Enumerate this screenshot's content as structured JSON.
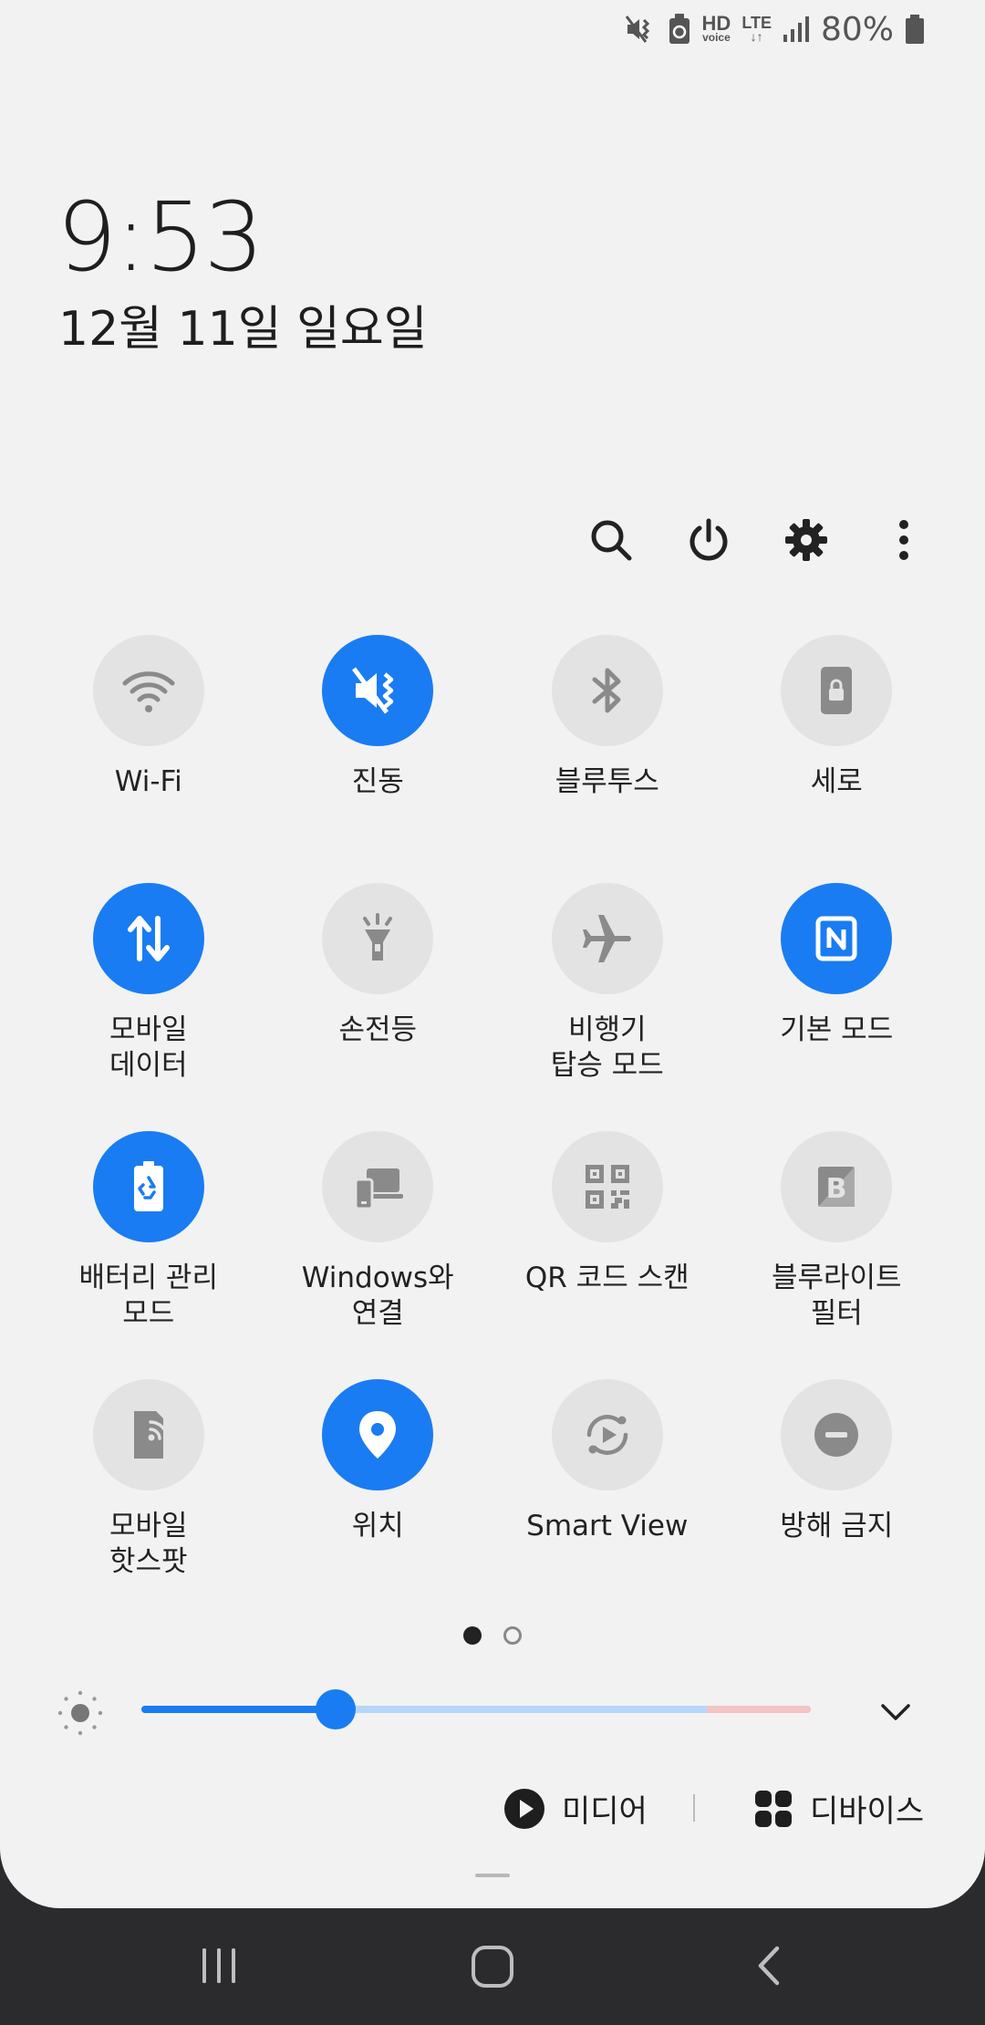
{
  "status_bar": {
    "hd_label": "HD",
    "hd_sub": "voice",
    "lte_label": "LTE",
    "lte_arrows": "↓↑",
    "battery_percent": "80%",
    "icons": [
      "vibrate-icon",
      "battery-saver-icon",
      "hd-voice-icon",
      "lte-icon",
      "signal-icon",
      "battery-icon"
    ]
  },
  "clock": {
    "time": "9:53",
    "date": "12월 11일 일요일"
  },
  "actions": [
    "search-icon",
    "power-icon",
    "settings-gear-icon",
    "more-options-icon"
  ],
  "tiles": [
    {
      "label": "Wi-Fi",
      "icon": "wifi-icon",
      "active": false
    },
    {
      "label": "진동",
      "icon": "vibrate-icon",
      "active": true
    },
    {
      "label": "블루투스",
      "icon": "bluetooth-icon",
      "active": false
    },
    {
      "label": "세로",
      "icon": "portrait-lock-icon",
      "active": false
    },
    {
      "label": "모바일\n데이터",
      "icon": "mobile-data-icon",
      "active": true
    },
    {
      "label": "손전등",
      "icon": "flashlight-icon",
      "active": false
    },
    {
      "label": "비행기\n탑승 모드",
      "icon": "airplane-icon",
      "active": false
    },
    {
      "label": "기본 모드",
      "icon": "nfc-icon",
      "active": true
    },
    {
      "label": "배터리 관리\n모드",
      "icon": "battery-saver-icon",
      "active": true
    },
    {
      "label": "Windows와\n연결",
      "icon": "link-windows-icon",
      "active": false
    },
    {
      "label": "QR 코드 스캔",
      "icon": "qr-code-icon",
      "active": false
    },
    {
      "label": "블루라이트\n필터",
      "icon": "blue-light-filter-icon",
      "active": false
    },
    {
      "label": "모바일\n핫스팟",
      "icon": "hotspot-icon",
      "active": false
    },
    {
      "label": "위치",
      "icon": "location-icon",
      "active": true
    },
    {
      "label": "Smart View",
      "icon": "smart-view-icon",
      "active": false
    },
    {
      "label": "방해 금지",
      "icon": "do-not-disturb-icon",
      "active": false
    }
  ],
  "pager": {
    "current": 1,
    "total": 2
  },
  "brightness": {
    "level": 0.29,
    "warn_start": 0.845
  },
  "bottom_buttons": {
    "media_label": "미디어",
    "devices_label": "디바이스"
  },
  "navbar": [
    "recents-icon",
    "home-icon",
    "back-icon"
  ],
  "colors": {
    "accent": "#1a7cf2",
    "tile_off": "#e3e3e3",
    "panel_bg": "#f2f2f2",
    "nav_bg": "#2b2b2d"
  }
}
